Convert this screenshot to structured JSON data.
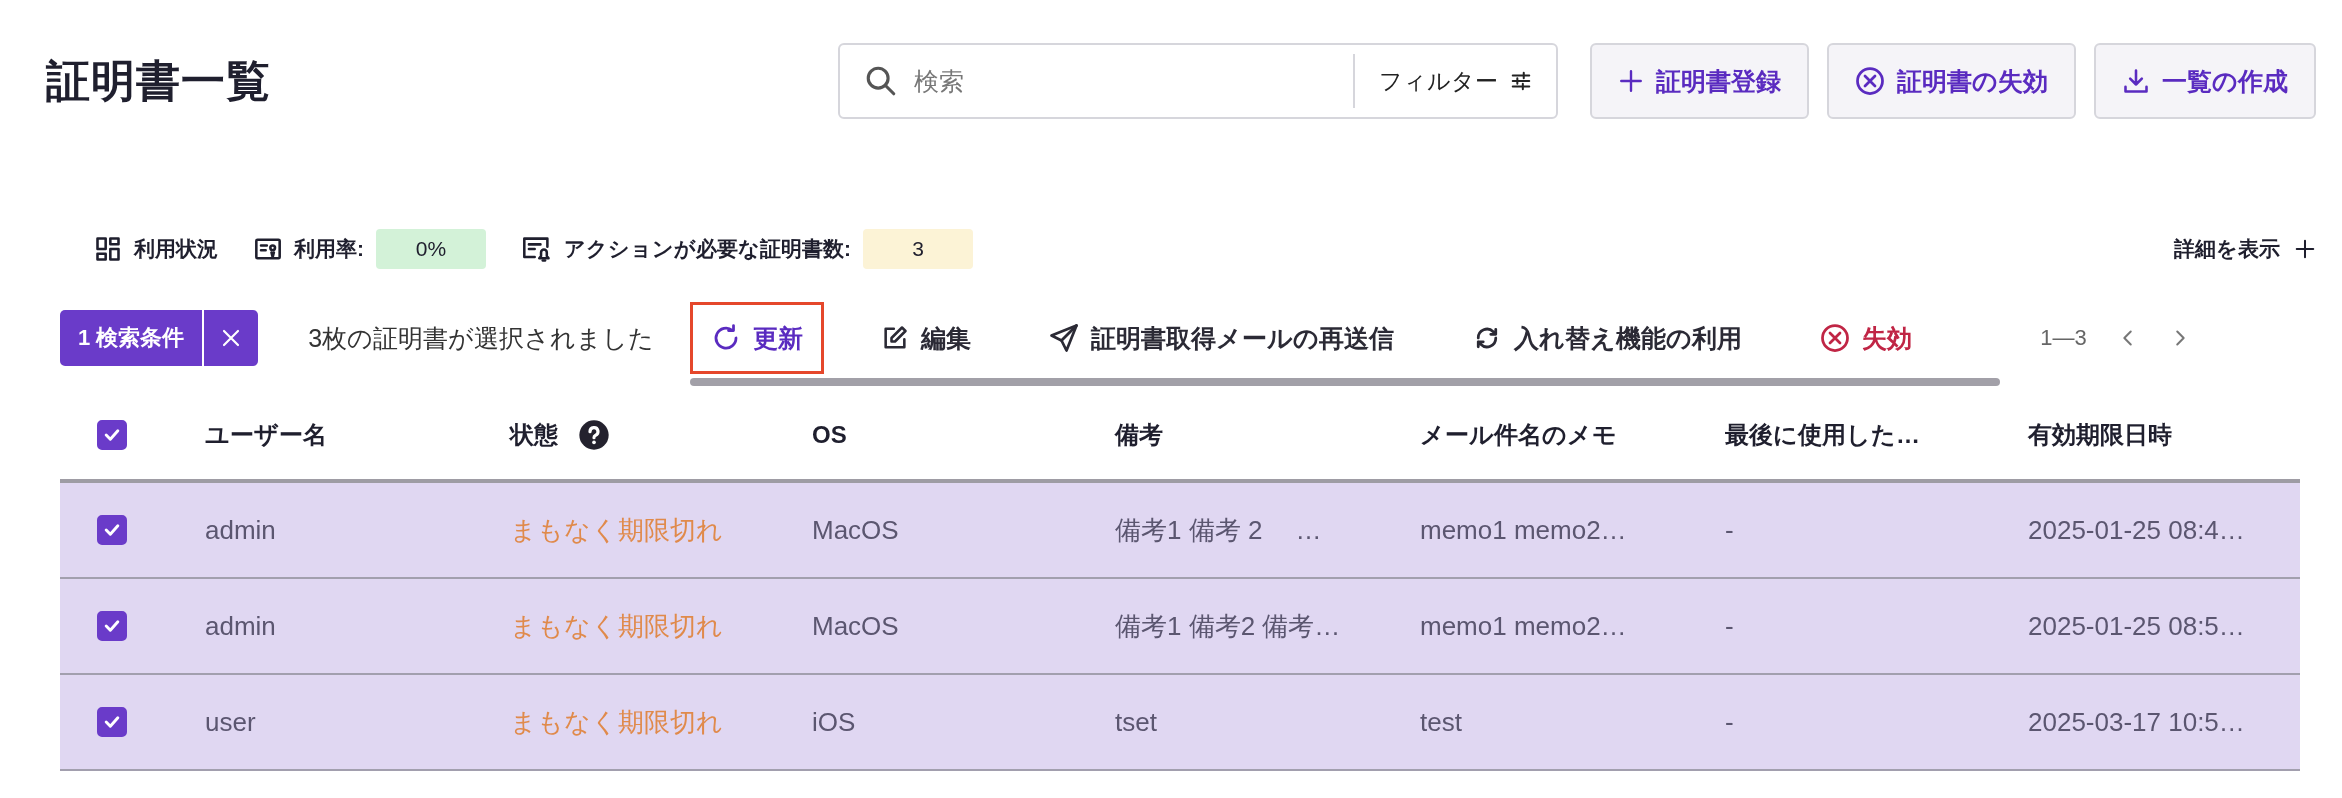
{
  "page": {
    "title": "証明書一覧"
  },
  "search": {
    "placeholder": "検索",
    "filter_label": "フィルター"
  },
  "header_buttons": [
    {
      "kind": "add",
      "label": "証明書登録"
    },
    {
      "kind": "revoke",
      "label": "証明書の失効"
    },
    {
      "kind": "download",
      "label": "一覧の作成"
    }
  ],
  "stats": [
    {
      "kind": "usage",
      "label": "利用状況"
    },
    {
      "kind": "rate",
      "label": "利用率:",
      "value": "0%",
      "color": "#d3f2d8"
    },
    {
      "kind": "action",
      "label": "アクションが必要な証明書数:",
      "value": "3",
      "color": "#fcf3d6"
    }
  ],
  "details_toggle": {
    "label": "詳細を表示",
    "expanded": false
  },
  "filter_chip": {
    "label": "1 検索条件"
  },
  "selection_text": "3枚の証明書が選択されました",
  "actions": [
    {
      "kind": "refresh",
      "label": "更新",
      "focused": true
    },
    {
      "kind": "edit",
      "label": "編集",
      "focused": false
    },
    {
      "kind": "send",
      "label": "証明書取得メールの再送信",
      "focused": false
    },
    {
      "kind": "swap",
      "label": "入れ替え機能の利用",
      "focused": false
    },
    {
      "kind": "revoke",
      "label": "失効",
      "focused": false
    }
  ],
  "pagination": {
    "range": "1—3"
  },
  "table": {
    "all_checked": true,
    "columns": [
      "ユーザー名",
      "状態",
      "OS",
      "備考",
      "メール件名のメモ",
      "最後に使用した…",
      "有効期限日時"
    ],
    "rows": [
      {
        "selected": true,
        "cells": [
          "admin",
          "まもなく期限切れ",
          "MacOS",
          "備考1 備考 2　 …",
          "memo1 memo2…",
          "-",
          "2025-01-25 08:4…"
        ]
      },
      {
        "selected": true,
        "cells": [
          "admin",
          "まもなく期限切れ",
          "MacOS",
          "備考1 備考2 備考…",
          "memo1 memo2…",
          "-",
          "2025-01-25 08:5…"
        ]
      },
      {
        "selected": true,
        "cells": [
          "user",
          "まもなく期限切れ",
          "iOS",
          "tset",
          "test",
          "-",
          "2025-03-17 10:5…"
        ]
      }
    ]
  }
}
